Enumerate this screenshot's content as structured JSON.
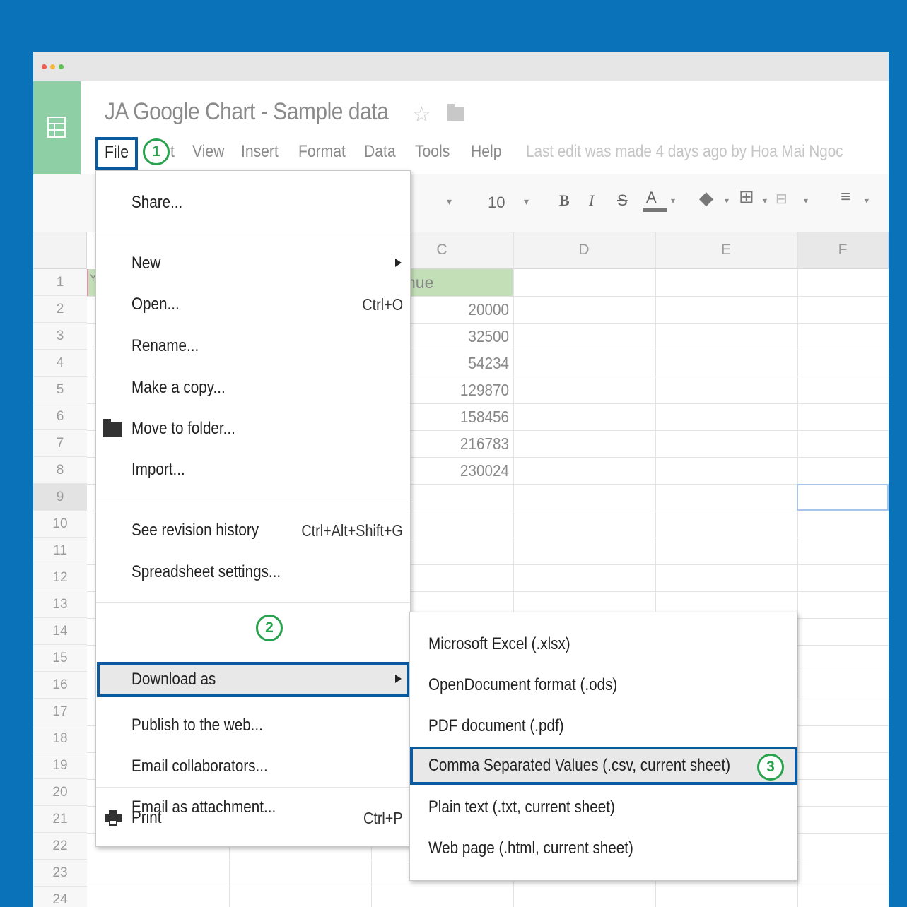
{
  "doc": {
    "title": "JA Google Chart - Sample data",
    "last_edit": "Last edit was made 4 days ago by Hoa Mai Ngoc"
  },
  "menubar": {
    "file": "File",
    "edit_fragment": "t",
    "view": "View",
    "insert": "Insert",
    "format": "Format",
    "data": "Data",
    "tools": "Tools",
    "help": "Help"
  },
  "toolbar": {
    "font_size": "10",
    "bold": "B",
    "italic": "I",
    "text_color": "A"
  },
  "columns": [
    "C",
    "D",
    "E",
    "F"
  ],
  "rows": [
    "1",
    "2",
    "3",
    "4",
    "5",
    "6",
    "7",
    "8",
    "9",
    "10",
    "11",
    "12",
    "13",
    "14",
    "15",
    "16",
    "17",
    "18",
    "19",
    "20",
    "21",
    "22",
    "23",
    "24"
  ],
  "sheet": {
    "a1_fragment": "Y",
    "header_fragment": "nue",
    "values": [
      "20000",
      "32500",
      "54234",
      "129870",
      "158456",
      "216783",
      "230024"
    ]
  },
  "file_menu": {
    "share": "Share...",
    "new": "New",
    "open": "Open...",
    "open_shortcut": "Ctrl+O",
    "rename": "Rename...",
    "make_copy": "Make a copy...",
    "move_folder": "Move to folder...",
    "import": "Import...",
    "revision_history": "See revision history",
    "revision_shortcut": "Ctrl+Alt+Shift+G",
    "settings": "Spreadsheet settings...",
    "download_as": "Download as",
    "publish": "Publish to the web...",
    "email_collab": "Email collaborators...",
    "email_attach": "Email as attachment...",
    "print": "Print",
    "print_shortcut": "Ctrl+P"
  },
  "download_menu": {
    "xlsx": "Microsoft Excel (.xlsx)",
    "ods": "OpenDocument format (.ods)",
    "pdf": "PDF document (.pdf)",
    "csv": "Comma Separated Values (.csv, current sheet)",
    "txt": "Plain text (.txt, current sheet)",
    "html": "Web page (.html, current sheet)"
  },
  "steps": {
    "one": "1",
    "two": "2",
    "three": "3"
  },
  "colors": {
    "accent": "#0a5aa0",
    "step_badge": "#27a24d",
    "background": "#0a72b9",
    "sheets_green": "#8fcfa6"
  }
}
